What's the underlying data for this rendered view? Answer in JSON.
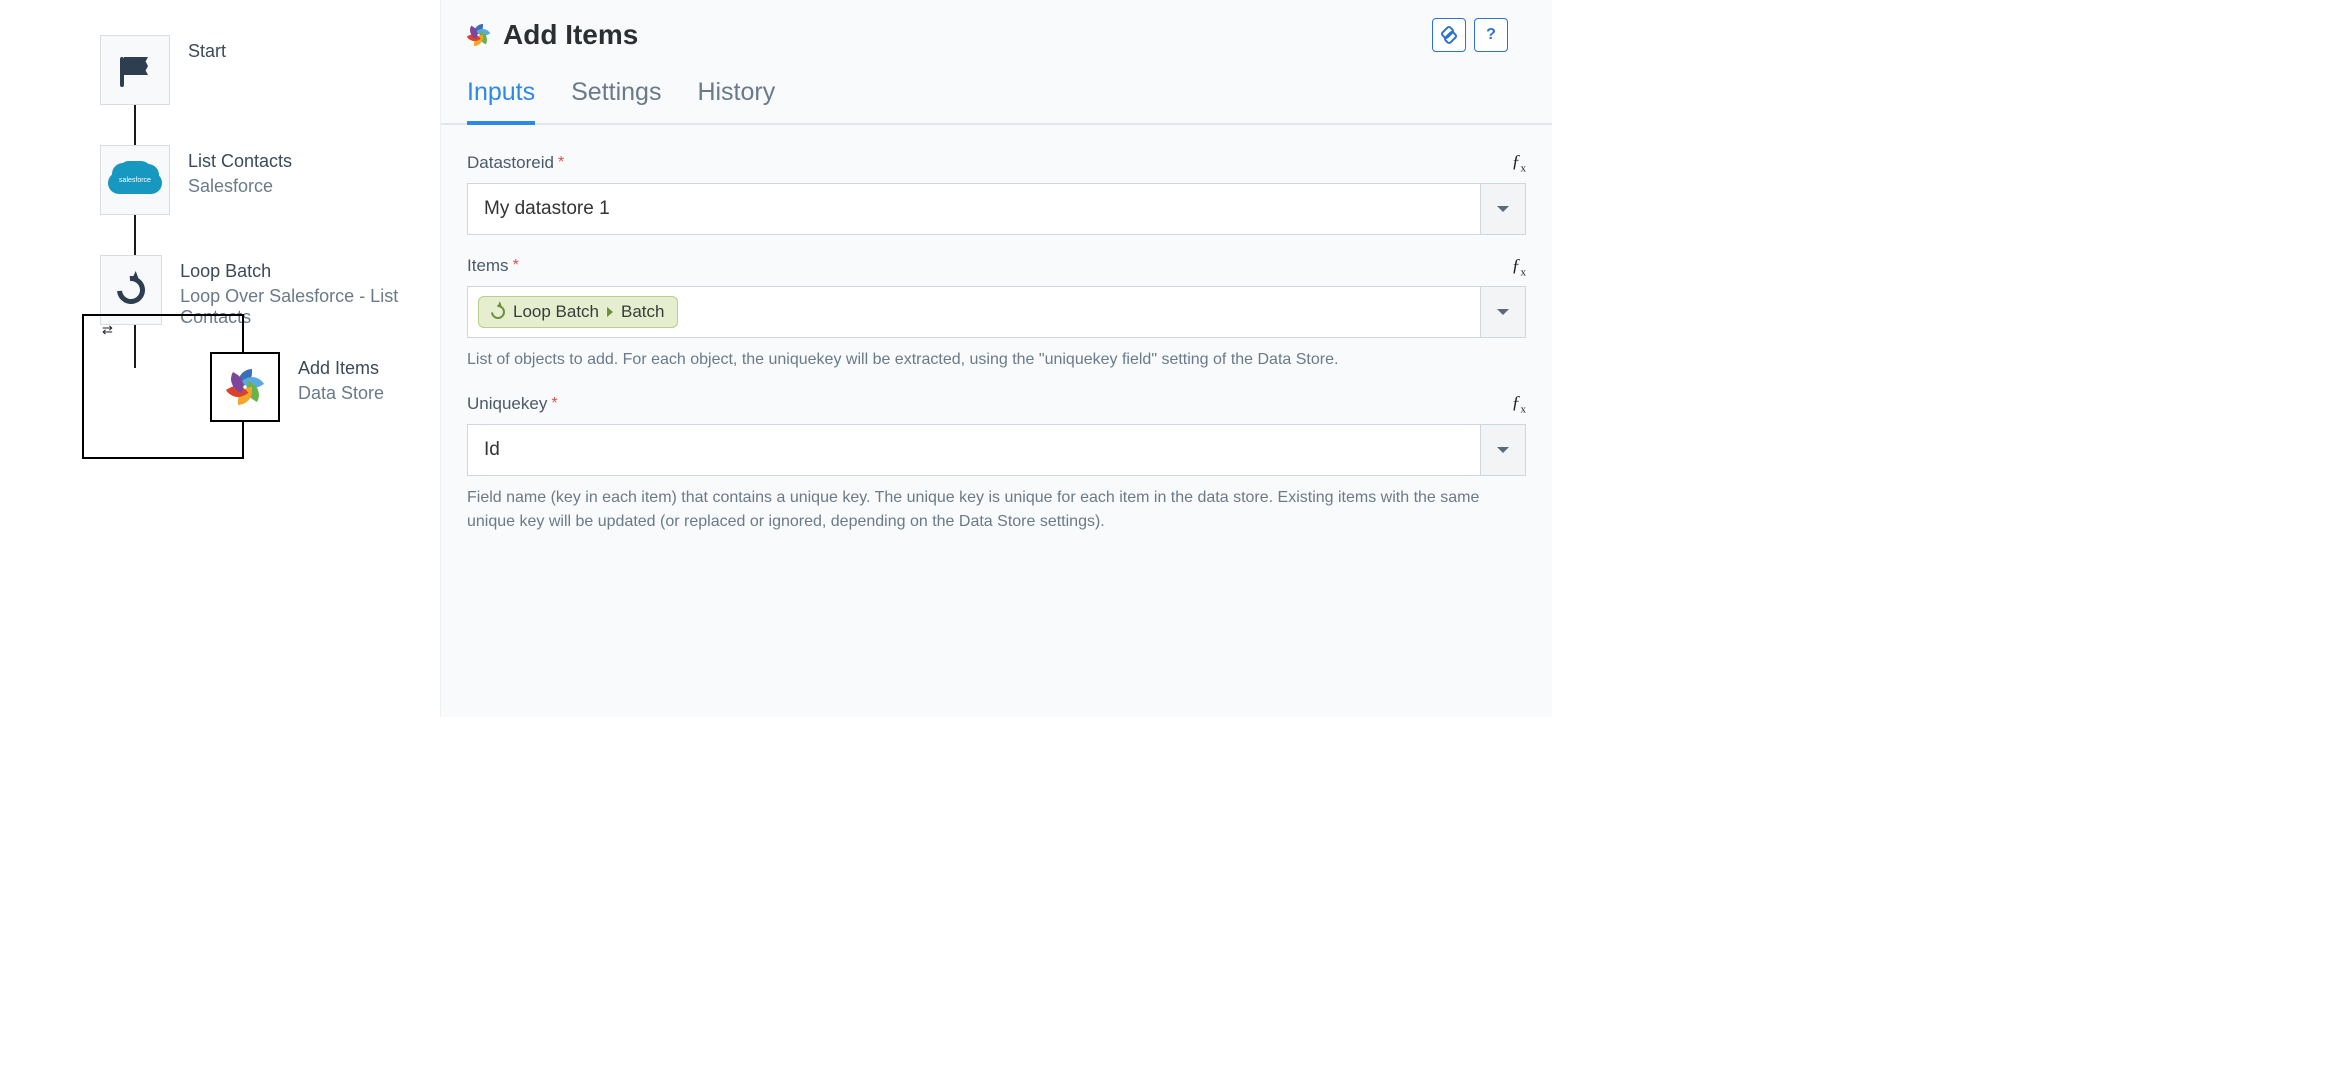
{
  "canvas": {
    "nodes": [
      {
        "title": "Start",
        "sub": ""
      },
      {
        "title": "List Contacts",
        "sub": "Salesforce"
      },
      {
        "title": "Loop Batch",
        "sub": "Loop Over Salesforce - List Contacts"
      },
      {
        "title": "Add Items",
        "sub": "Data Store"
      }
    ]
  },
  "panel": {
    "title": "Add Items",
    "tabs": [
      "Inputs",
      "Settings",
      "History"
    ],
    "active_tab": 0,
    "fields": {
      "datastoreid": {
        "label": "Datastoreid",
        "value": "My datastore 1"
      },
      "items": {
        "label": "Items",
        "pill_source": "Loop Batch",
        "pill_value": "Batch",
        "help": "List of objects to add. For each object, the uniquekey will be extracted, using the \"uniquekey field\" setting of the Data Store."
      },
      "uniquekey": {
        "label": "Uniquekey",
        "value": "Id",
        "help": "Field name (key in each item) that contains a unique key. The unique key is unique for each item in the data store. Existing items with the same unique key will be updated (or replaced or ignored, depending on the Data Store settings)."
      }
    },
    "help_button": "?"
  }
}
